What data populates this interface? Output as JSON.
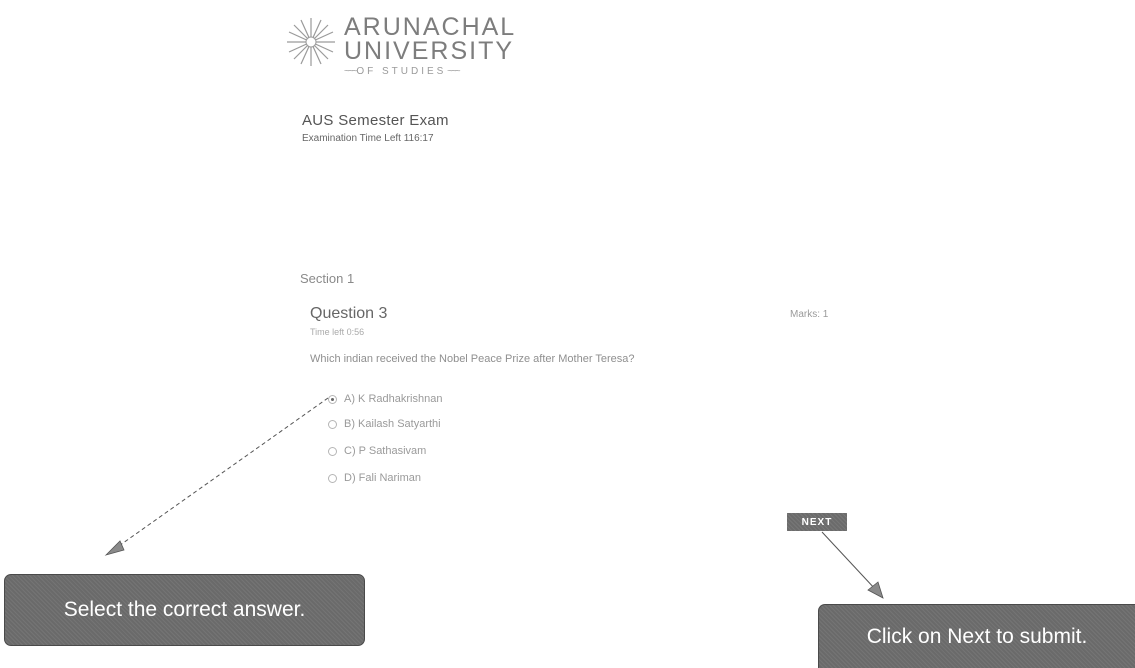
{
  "logo": {
    "line1": "ARUNACHAL",
    "line2": "UNIVERSITY",
    "line3": "OF STUDIES"
  },
  "exam": {
    "title": "AUS Semester Exam",
    "time_left": "Examination Time Left 116:17"
  },
  "section": {
    "label": "Section 1"
  },
  "question": {
    "title": "Question 3",
    "marks": "Marks: 1",
    "time_left": "Time left 0:56",
    "text": "Which indian received the Nobel Peace Prize after Mother Teresa?",
    "options": [
      {
        "label": "A) K Radhakrishnan",
        "selected": true
      },
      {
        "label": "B) Kailash Satyarthi",
        "selected": false
      },
      {
        "label": "C) P Sathasivam",
        "selected": false
      },
      {
        "label": "D) Fali Nariman",
        "selected": false
      }
    ]
  },
  "next_button": {
    "label": "NEXT"
  },
  "callouts": {
    "select_answer": "Select the correct answer.",
    "click_next": "Click on Next to submit."
  },
  "colors": {
    "callout_bg": "#6a6a6a",
    "next_bg": "#6b6b6b",
    "text_gray": "#8a8a8a"
  }
}
